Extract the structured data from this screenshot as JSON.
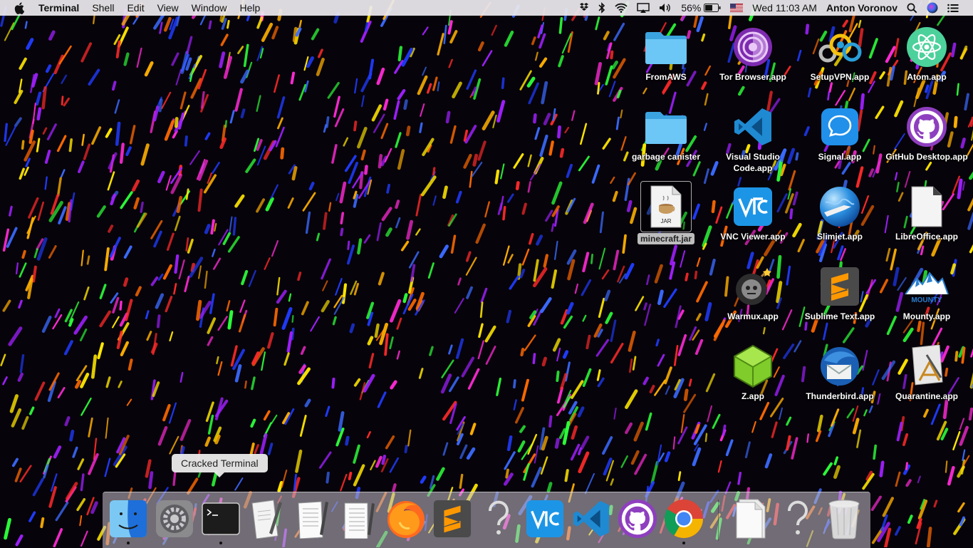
{
  "menubar": {
    "app_name": "Terminal",
    "menus": [
      "Shell",
      "Edit",
      "View",
      "Window",
      "Help"
    ],
    "battery": "56%",
    "clock": "Wed 11:03 AM",
    "user": "Anton Voronov"
  },
  "desktop": {
    "icons": [
      {
        "label": "FromAWS",
        "icon": "folder-icon"
      },
      {
        "label": "Tor Browser.app",
        "icon": "tor-browser-icon"
      },
      {
        "label": "SetupVPN.app",
        "icon": "setupvpn-icon"
      },
      {
        "label": "Atom.app",
        "icon": "atom-icon"
      },
      {
        "label": "garbage canister",
        "icon": "folder-icon"
      },
      {
        "label": "Visual Studio Code.app",
        "icon": "vscode-icon"
      },
      {
        "label": "Signal.app",
        "icon": "signal-icon"
      },
      {
        "label": "GitHub Desktop.app",
        "icon": "github-desktop-icon"
      },
      {
        "label": "minecraft.jar",
        "icon": "jar-file-icon",
        "icon_text": "JAR"
      },
      {
        "label": "VNC Viewer.app",
        "icon": "vnc-viewer-icon"
      },
      {
        "label": "Slimjet.app",
        "icon": "slimjet-icon"
      },
      {
        "label": "LibreOffice.app",
        "icon": "libreoffice-icon"
      },
      {
        "label": "Warmux.app",
        "icon": "warmux-icon"
      },
      {
        "label": "Sublime Text.app",
        "icon": "sublime-text-icon"
      },
      {
        "label": "Mounty.app",
        "icon": "mounty-icon",
        "icon_text": "MOUNTY"
      },
      {
        "label": "Z.app",
        "icon": "z-app-icon"
      },
      {
        "label": "Thunderbird.app",
        "icon": "thunderbird-icon"
      },
      {
        "label": "Quarantine.app",
        "icon": "quarantine-icon"
      }
    ]
  },
  "tooltip": "Cracked Terminal",
  "dock": {
    "items": [
      {
        "icon": "finder-icon",
        "running": true
      },
      {
        "icon": "system-preferences-icon",
        "running": false
      },
      {
        "icon": "terminal-icon",
        "running": true
      },
      {
        "icon": "script-editor-icon",
        "running": false
      },
      {
        "icon": "textedit-icon",
        "running": false
      },
      {
        "icon": "textedit-icon",
        "running": false
      },
      {
        "icon": "firefox-icon",
        "running": false
      },
      {
        "icon": "sublime-text-icon",
        "running": false
      },
      {
        "icon": "unknown-app-icon",
        "running": false
      },
      {
        "icon": "vnc-viewer-icon",
        "running": false
      },
      {
        "icon": "vscode-icon",
        "running": false
      },
      {
        "icon": "github-desktop-icon",
        "running": false
      },
      {
        "icon": "chrome-icon",
        "running": true
      },
      {
        "icon": "document-stack-icon",
        "running": false
      },
      {
        "icon": "unknown-app-icon",
        "running": false
      },
      {
        "icon": "trash-icon",
        "running": false
      }
    ]
  }
}
